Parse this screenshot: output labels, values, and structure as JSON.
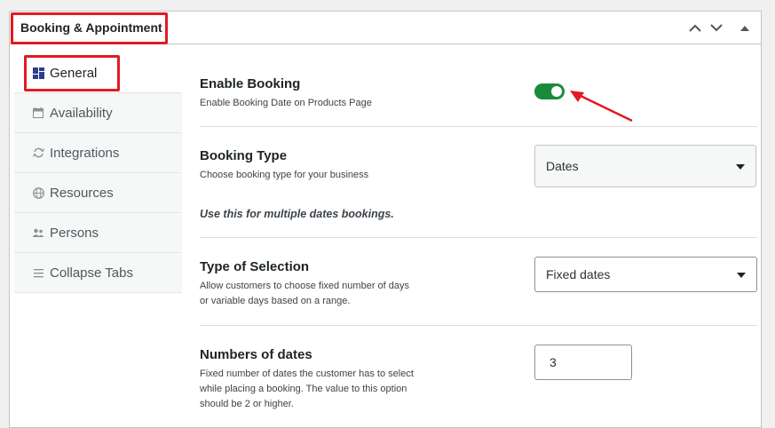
{
  "header": {
    "title": "Booking & Appointment"
  },
  "tabs": [
    {
      "label": "General",
      "icon": "dashboard-grid-icon"
    },
    {
      "label": "Availability",
      "icon": "calendar-icon"
    },
    {
      "label": "Integrations",
      "icon": "sync-icon"
    },
    {
      "label": "Resources",
      "icon": "globe-icon"
    },
    {
      "label": "Persons",
      "icon": "persons-icon"
    },
    {
      "label": "Collapse Tabs",
      "icon": "menu-lines-icon"
    }
  ],
  "fields": {
    "enable_booking": {
      "title": "Enable Booking",
      "desc": "Enable Booking Date on Products Page",
      "enabled": true
    },
    "booking_type": {
      "title": "Booking Type",
      "desc": "Choose booking type for your business",
      "value": "Dates",
      "note": "Use this for multiple dates bookings."
    },
    "type_of_selection": {
      "title": "Type of Selection",
      "desc": "Allow customers to choose fixed number of days or variable days based on a range.",
      "value": "Fixed dates"
    },
    "numbers_of_dates": {
      "title": "Numbers of dates",
      "desc": "Fixed number of dates the customer has to select while placing a booking. The value to this option should be 2 or higher.",
      "value": "3"
    }
  },
  "colors": {
    "accent_green": "#1a8b3a",
    "highlight_red": "#e01b24"
  }
}
